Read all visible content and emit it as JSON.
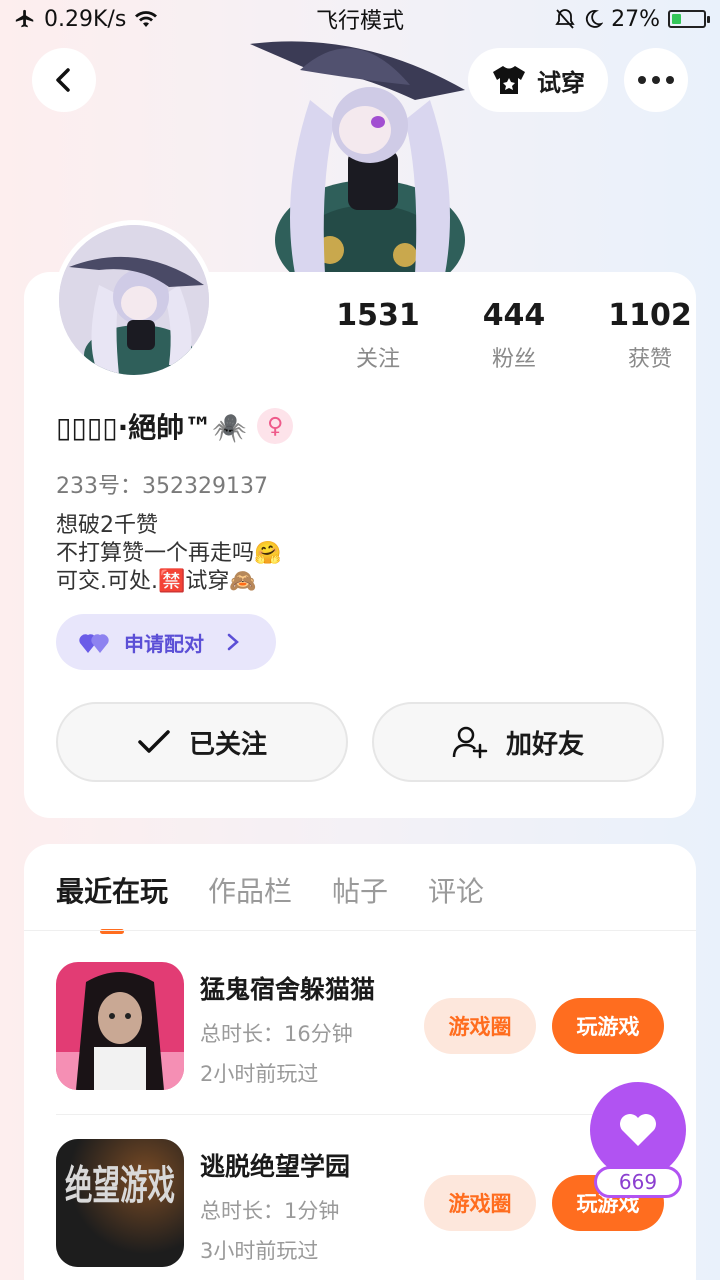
{
  "status_bar": {
    "net_speed": "0.29K/s",
    "mode": "飞行模式",
    "battery_pct": "27%",
    "battery_level": 0.27
  },
  "header": {
    "tryon_label": "试穿"
  },
  "profile": {
    "name": "▯▯▯▯·絕帥™🕷️",
    "gender_symbol": "♀",
    "id_text": "233号：352329137",
    "bio": [
      "想破2千赞",
      "不打算赞一个再走吗🤗",
      "可交.可处.🈲试穿🙈"
    ],
    "stats": [
      {
        "value": "1531",
        "label": "关注"
      },
      {
        "value": "444",
        "label": "粉丝"
      },
      {
        "value": "1102",
        "label": "获赞"
      }
    ],
    "pair_label": "申请配对",
    "followed_label": "已关注",
    "add_friend_label": "加好友"
  },
  "tabs": [
    "最近在玩",
    "作品栏",
    "帖子",
    "评论"
  ],
  "games": [
    {
      "title": "猛鬼宿舍躲猫猫",
      "duration": "总时长：16分钟",
      "last_played": "2小时前玩过",
      "circle_label": "游戏圈",
      "play_label": "玩游戏"
    },
    {
      "title": "逃脱绝望学园",
      "duration": "总时长：1分钟",
      "last_played": "3小时前玩过",
      "circle_label": "游戏圈",
      "play_label": "玩游戏",
      "icon_text": "绝望游戏"
    }
  ],
  "floating_like": {
    "count": "669"
  },
  "colors": {
    "accent": "#ff6d1f",
    "like": "#b153f2",
    "pair": "#5b4fd6"
  }
}
